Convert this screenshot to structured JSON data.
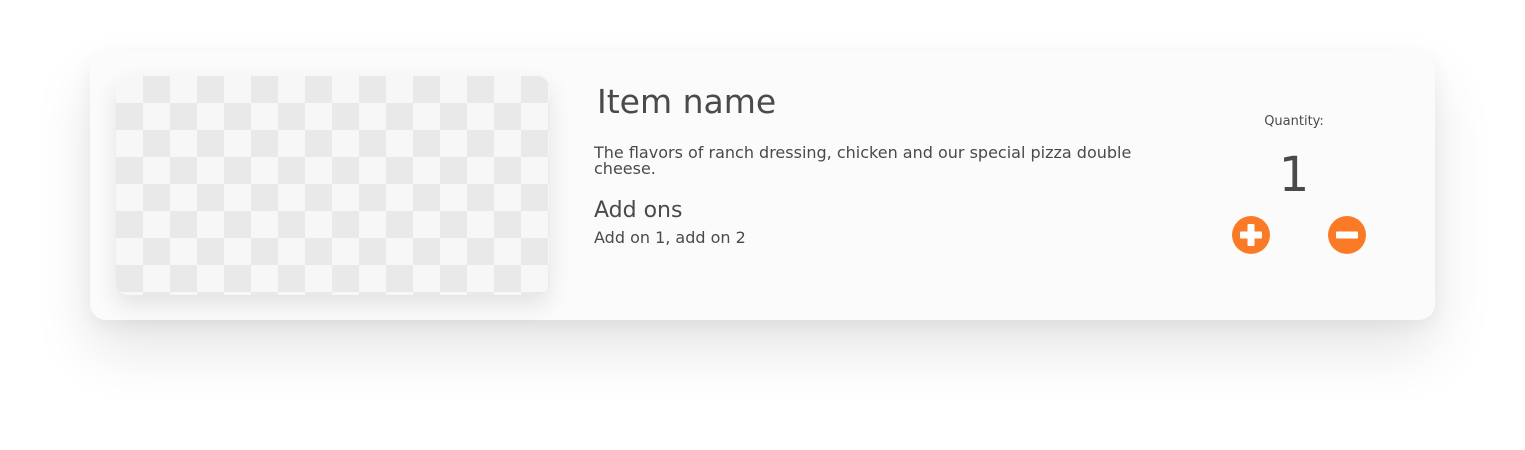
{
  "item": {
    "name": "Item name",
    "description": "The flavors of ranch dressing, chicken and our special pizza double cheese.",
    "addons_title": "Add ons",
    "addons_list": "Add on 1, add on 2",
    "image_icon": "transparent-checkerboard-placeholder"
  },
  "quantity": {
    "label": "Quantity:",
    "value": "1",
    "increase_icon": "plus-circle-icon",
    "decrease_icon": "minus-circle-icon"
  },
  "colors": {
    "accent": "#fb7a26",
    "text": "#4a4a4a",
    "card_background": "#fcfbfb"
  }
}
